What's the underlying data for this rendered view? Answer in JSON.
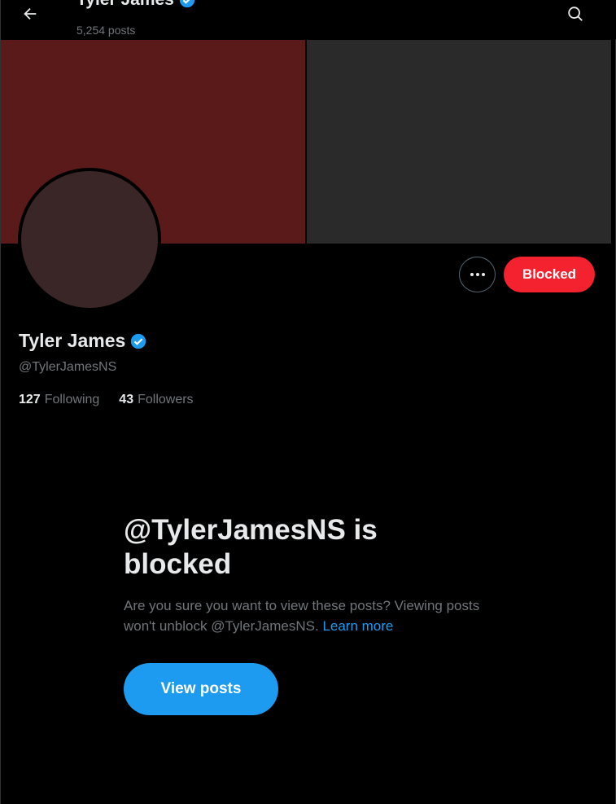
{
  "colors": {
    "background": "#000000",
    "text_primary": "#e7e9ea",
    "text_secondary": "#71767b",
    "accent_blue": "#1d9bf0",
    "blocked_red": "#f4212e"
  },
  "header": {
    "back_icon": "arrow-left-icon",
    "title": "Tyler James",
    "verified_icon": "verified-badge-icon",
    "post_count": "5,254 posts",
    "search_icon": "search-icon"
  },
  "profile": {
    "display_name": "Tyler James",
    "handle": "@TylerJamesNS",
    "more_icon": "more-horizontal-icon",
    "blocked_label": "Blocked",
    "following_count": "127",
    "following_label": "Following",
    "followers_count": "43",
    "followers_label": "Followers"
  },
  "blocked_notice": {
    "title": "@TylerJamesNS is blocked",
    "body": "Are you sure you want to view these posts? Viewing posts won't unblock @TylerJamesNS.",
    "learn_more": "Learn more",
    "view_posts_label": "View posts"
  }
}
